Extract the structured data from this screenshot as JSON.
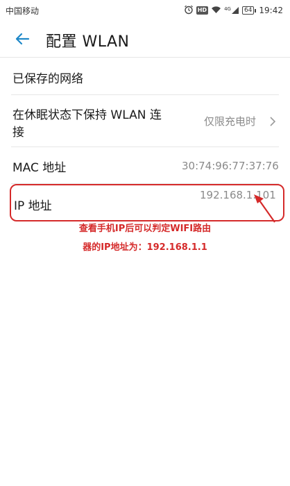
{
  "status_bar": {
    "carrier": "中国移动",
    "hd_badge": "HD",
    "network": "4G",
    "battery": "64",
    "time": "19:42"
  },
  "app_bar": {
    "title": "配置 WLAN"
  },
  "settings": {
    "saved_networks": "已保存的网络",
    "keep_wlan_sleep": {
      "label_line1": "在休眠状态下保持 WLAN 连",
      "label_line2": "接",
      "value": "仅限充电时"
    },
    "mac": {
      "label": "MAC 地址",
      "value": "30:74:96:77:37:76"
    },
    "ip": {
      "label": "IP 地址",
      "value": "192.168.1.101"
    }
  },
  "annotation": {
    "line1": "查看手机IP后可以判定WIFI路由",
    "line2": "器的IP地址为：192.168.1.1",
    "color": "#d52a2a"
  },
  "colors": {
    "accent": "#1e88c8",
    "text_primary": "#1a1a1a",
    "text_secondary": "#8a8a8a"
  }
}
